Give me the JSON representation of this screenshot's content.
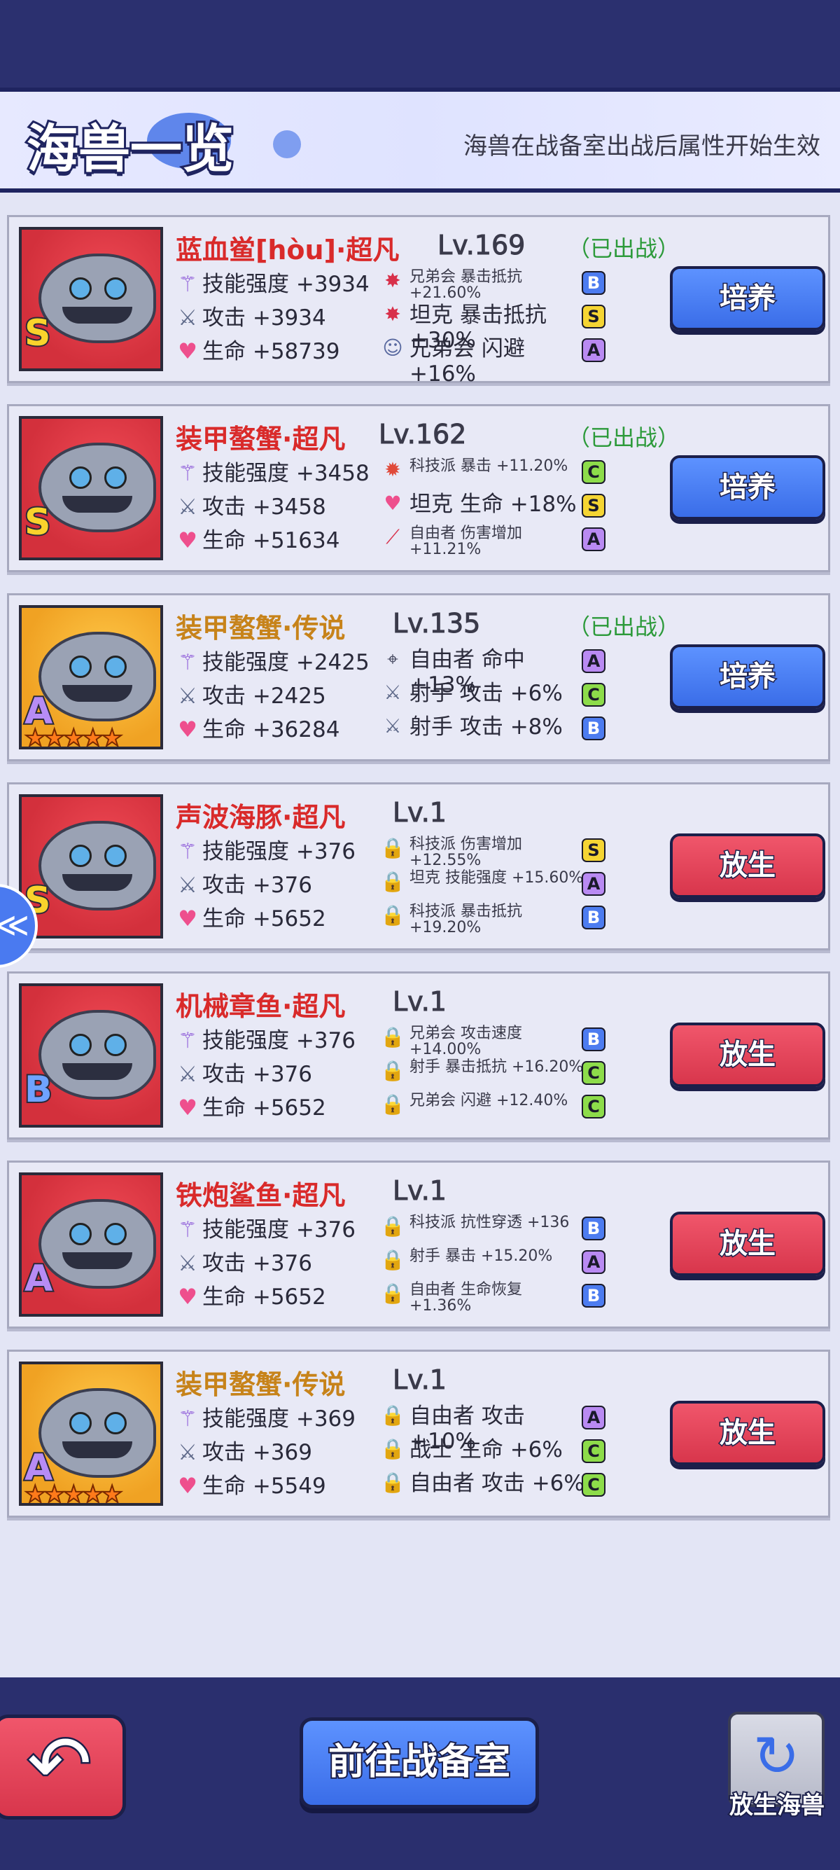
{
  "header": {
    "title": "海兽一览",
    "subtitle": "海兽在战备室出战后属性开始生效"
  },
  "monsters": [
    {
      "name": "蓝血鲎[hòu]·超凡",
      "name_color": "red",
      "level": "Lv.169",
      "status": "（已出战）",
      "grade": "S",
      "stars": "",
      "stats": {
        "skill": "技能强度 +3934",
        "attack": "攻击 +3934",
        "hp": "生命 +58739"
      },
      "bonuses": [
        {
          "icon": "claw-icon",
          "text": "兄弟会 暴击抵抗 +21.60%",
          "size": "small",
          "tier": "B"
        },
        {
          "icon": "claw-icon",
          "text": "坦克 暴击抵抗 +30%",
          "size": "big",
          "tier": "S"
        },
        {
          "icon": "dodge-icon",
          "text": "兄弟会 闪避 +16%",
          "size": "big",
          "tier": "A"
        }
      ],
      "button": "培养",
      "button_color": "blue"
    },
    {
      "name": "装甲螯蟹·超凡",
      "name_color": "red",
      "level": "Lv.162",
      "status": "（已出战）",
      "grade": "S",
      "stars": "",
      "stats": {
        "skill": "技能强度 +3458",
        "attack": "攻击 +3458",
        "hp": "生命 +51634"
      },
      "bonuses": [
        {
          "icon": "crit-icon",
          "text": "科技派 暴击 +11.20%",
          "size": "small",
          "tier": "C"
        },
        {
          "icon": "heart-icon",
          "text": "坦克 生命 +18%",
          "size": "big",
          "tier": "S"
        },
        {
          "icon": "slash-icon",
          "text": "自由者 伤害增加 +11.21%",
          "size": "small",
          "tier": "A"
        }
      ],
      "button": "培养",
      "button_color": "blue"
    },
    {
      "name": "装甲螯蟹·传说",
      "name_color": "gold",
      "level": "Lv.135",
      "status": "（已出战）",
      "grade": "A",
      "stars": "★★★★★",
      "stats": {
        "skill": "技能强度 +2425",
        "attack": "攻击 +2425",
        "hp": "生命 +36284"
      },
      "bonuses": [
        {
          "icon": "crosshair-icon",
          "text": "自由者 命中 +13%",
          "size": "big",
          "tier": "A"
        },
        {
          "icon": "sword-icon",
          "text": "射手 攻击 +6%",
          "size": "big",
          "tier": "C"
        },
        {
          "icon": "sword-icon",
          "text": "射手 攻击 +8%",
          "size": "big",
          "tier": "B"
        }
      ],
      "button": "培养",
      "button_color": "blue"
    },
    {
      "name": "声波海豚·超凡",
      "name_color": "red",
      "level": "Lv.1",
      "status": "",
      "grade": "S",
      "stars": "",
      "stats": {
        "skill": "技能强度 +376",
        "attack": "攻击 +376",
        "hp": "生命 +5652"
      },
      "bonuses": [
        {
          "icon": "lock-icon",
          "text": "科技派 伤害增加 +12.55%",
          "size": "small",
          "tier": "S"
        },
        {
          "icon": "lock-icon",
          "text": "坦克 技能强度 +15.60%",
          "size": "small",
          "tier": "A"
        },
        {
          "icon": "lock-icon",
          "text": "科技派 暴击抵抗 +19.20%",
          "size": "small",
          "tier": "B"
        }
      ],
      "button": "放生",
      "button_color": "red"
    },
    {
      "name": "机械章鱼·超凡",
      "name_color": "red",
      "level": "Lv.1",
      "status": "",
      "grade": "B",
      "stars": "",
      "stats": {
        "skill": "技能强度 +376",
        "attack": "攻击 +376",
        "hp": "生命 +5652"
      },
      "bonuses": [
        {
          "icon": "lock-icon",
          "text": "兄弟会 攻击速度 +14.00%",
          "size": "small",
          "tier": "B"
        },
        {
          "icon": "lock-icon",
          "text": "射手 暴击抵抗 +16.20%",
          "size": "small",
          "tier": "C"
        },
        {
          "icon": "lock-icon",
          "text": "兄弟会 闪避 +12.40%",
          "size": "small",
          "tier": "C"
        }
      ],
      "button": "放生",
      "button_color": "red"
    },
    {
      "name": "铁炮鲨鱼·超凡",
      "name_color": "red",
      "level": "Lv.1",
      "status": "",
      "grade": "A",
      "stars": "",
      "stats": {
        "skill": "技能强度 +376",
        "attack": "攻击 +376",
        "hp": "生命 +5652"
      },
      "bonuses": [
        {
          "icon": "lock-icon",
          "text": "科技派 抗性穿透 +136",
          "size": "small",
          "tier": "B"
        },
        {
          "icon": "lock-icon",
          "text": "射手 暴击 +15.20%",
          "size": "small",
          "tier": "A"
        },
        {
          "icon": "lock-icon",
          "text": "自由者 生命恢复 +1.36%",
          "size": "small",
          "tier": "B"
        }
      ],
      "button": "放生",
      "button_color": "red"
    },
    {
      "name": "装甲螯蟹·传说",
      "name_color": "gold",
      "level": "Lv.1",
      "status": "",
      "grade": "A",
      "stars": "★★★★★",
      "stats": {
        "skill": "技能强度 +369",
        "attack": "攻击 +369",
        "hp": "生命 +5549"
      },
      "bonuses": [
        {
          "icon": "lock-icon",
          "text": "自由者 攻击 +10%",
          "size": "big",
          "tier": "A"
        },
        {
          "icon": "lock-icon",
          "text": "战士 生命 +6%",
          "size": "big",
          "tier": "C"
        },
        {
          "icon": "lock-icon",
          "text": "自由者 攻击 +6%",
          "size": "big",
          "tier": "C"
        }
      ],
      "button": "放生",
      "button_color": "red"
    }
  ],
  "footer": {
    "goto_label": "前往战备室",
    "release_label": "放生海兽"
  }
}
